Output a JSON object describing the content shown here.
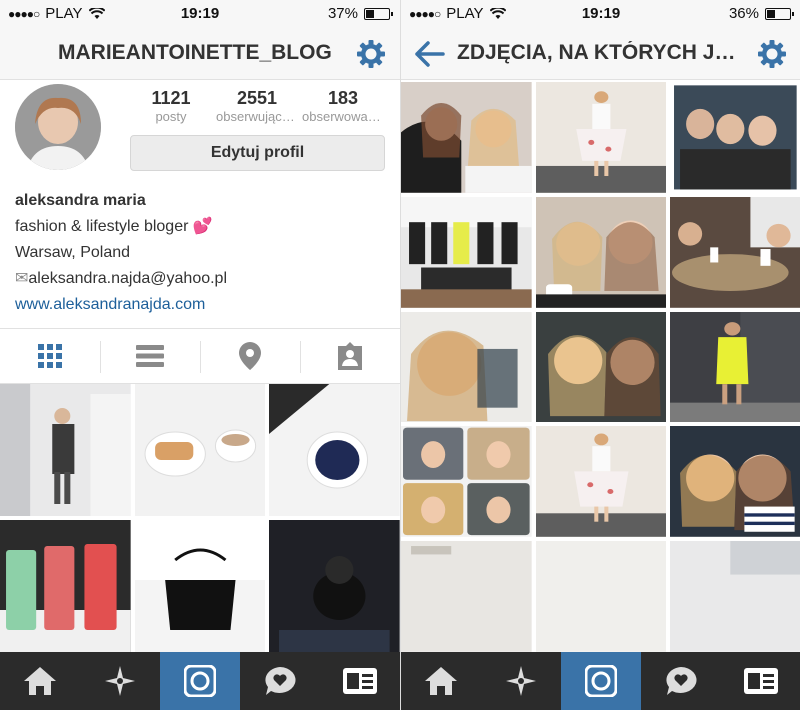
{
  "status_left": {
    "carrier": "PLAY",
    "time": "19:19",
    "battery": "37%",
    "battery_level": 0.37
  },
  "status_right": {
    "carrier": "PLAY",
    "time": "19:19",
    "battery": "36%",
    "battery_level": 0.36
  },
  "profile": {
    "username": "MARIEANTOINETTE_BLOG",
    "stats": [
      {
        "value": "1121",
        "label": "posty"
      },
      {
        "value": "2551",
        "label": "obserwujących"
      },
      {
        "value": "183",
        "label": "obserwowanych"
      }
    ],
    "edit_button": "Edytuj profil",
    "name": "aleksandra maria",
    "bio_line": "fashion & lifestyle bloger",
    "location": "Warsaw, Poland",
    "email": "aleksandra.najda@yahoo.pl",
    "website": "www.aleksandranajda.com"
  },
  "tagged": {
    "title": "ZDJĘCIA, NA KTÓRYCH J…"
  },
  "profile_tabs": [
    "grid-icon",
    "list-icon",
    "location-pin-icon",
    "tagged-person-icon"
  ],
  "bottom_tabs": [
    "home-icon",
    "explore-icon",
    "camera-icon",
    "activity-icon",
    "profile-icon"
  ],
  "colors": {
    "accent": "#3a73a8",
    "link": "#1d5f9a",
    "tabbar": "#2b2b2b"
  }
}
